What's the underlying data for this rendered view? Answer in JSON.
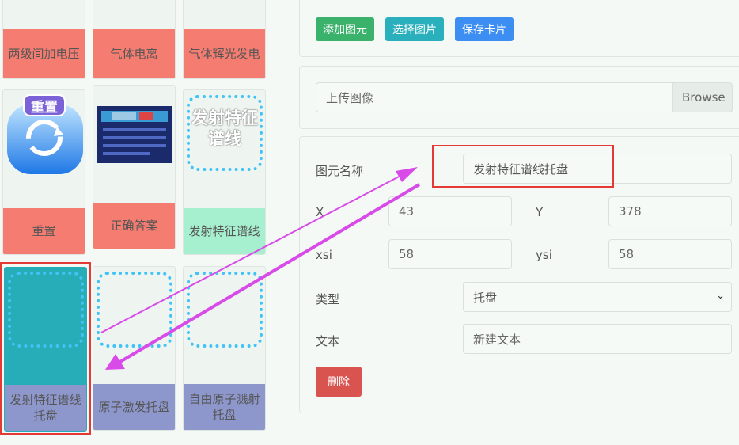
{
  "palette": {
    "cards": [
      {
        "label": "两级间加电压"
      },
      {
        "label": "气体电离"
      },
      {
        "label": "气体辉光发电"
      },
      {
        "label": "重置",
        "icon": "reset-icon",
        "icon_text": "重置"
      },
      {
        "label": "正确答案",
        "icon": "answer-slide-thumbnail"
      },
      {
        "label": "发射特征谱线",
        "icon_text": "发射特征谱线"
      },
      {
        "label": "发射特征谱线托盘"
      },
      {
        "label": "原子激发托盘"
      },
      {
        "label": "自由原子溅射托盘"
      }
    ]
  },
  "toolbar": {
    "add_label": "添加图元",
    "select_label": "选择图片",
    "save_label": "保存卡片"
  },
  "upload": {
    "placeholder": "上传图像",
    "browse_label": "Browse"
  },
  "form": {
    "name_label": "图元名称",
    "name_value": "发射特征谱线托盘",
    "x_label": "X",
    "x_value": "43",
    "y_label": "Y",
    "y_value": "378",
    "xsi_label": "xsi",
    "xsi_value": "58",
    "ysi_label": "ysi",
    "ysi_value": "58",
    "type_label": "类型",
    "type_value": "托盘",
    "text_label": "文本",
    "text_value": "新建文本",
    "delete_label": "删除"
  },
  "colors": {
    "add": "#3ab26c",
    "select": "#2ab0bd",
    "save": "#3d8ef2",
    "delete": "#d9534f",
    "highlight": "#e53935",
    "arrow": "#d84be8"
  }
}
